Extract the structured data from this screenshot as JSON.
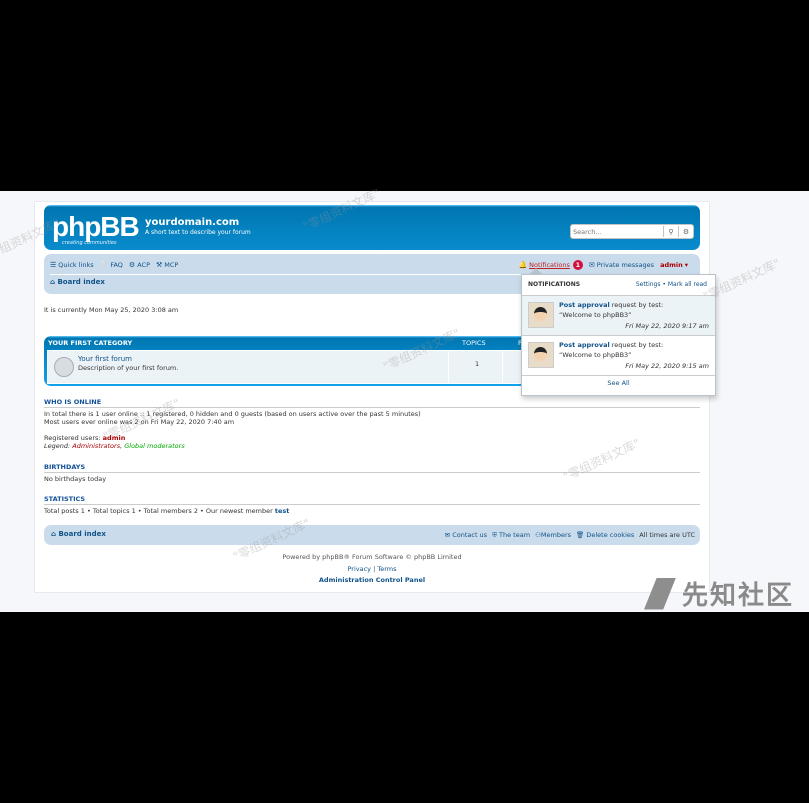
{
  "header": {
    "logo_text": "phpBB",
    "logo_tagline": "creating communities",
    "site_title": "yourdomain.com",
    "site_description": "A short text to describe your forum",
    "search_placeholder": "Search…"
  },
  "nav": {
    "quick_links": "Quick links",
    "faq": "FAQ",
    "acp": "ACP",
    "mcp": "MCP",
    "notifications": "Notifications",
    "notifications_count": "1",
    "private_messages": "Private messages",
    "username": "admin",
    "board_index": "Board index"
  },
  "current_time": "It is currently Mon May 25, 2020 3:08 am",
  "category": {
    "title": "YOUR FIRST CATEGORY",
    "col_topics": "TOPICS",
    "col_posts": "P",
    "forum_name": "Your first forum",
    "forum_desc": "Description of your first forum.",
    "topics_count": "1"
  },
  "who_is_online": {
    "heading": "WHO IS ONLINE",
    "line1": "In total there is 1 user online :: 1 registered, 0 hidden and 0 guests (based on users active over the past 5 minutes)",
    "line2": "Most users ever online was 2 on Fri May 22, 2020 7:40 am",
    "registered_label": "Registered users:",
    "registered_user": "admin",
    "legend_label": "Legend:",
    "legend_admins": "Administrators",
    "legend_sep": ",",
    "legend_gmods": "Global moderators"
  },
  "birthdays": {
    "heading": "BIRTHDAYS",
    "text": "No birthdays today"
  },
  "statistics": {
    "heading": "STATISTICS",
    "text": "Total posts 1 • Total topics 1 • Total members 2 • Our newest member",
    "newest": "test"
  },
  "footer_nav": {
    "board_index": "Board index",
    "contact": "Contact us",
    "team": "The team",
    "members": "Members",
    "delete_cookies": "Delete cookies",
    "timezone": "All times are UTC"
  },
  "footer": {
    "powered": "Powered by phpBB® Forum Software © phpBB Limited",
    "privacy": "Privacy",
    "sep": "|",
    "terms": "Terms",
    "acp": "Administration Control Panel"
  },
  "notifications_dropdown": {
    "title": "NOTIFICATIONS",
    "settings": "Settings",
    "dot": "•",
    "mark_all": "Mark all read",
    "items": [
      {
        "title_bold": "Post approval",
        "title_rest": " request by test:",
        "quote": "“Welcome to phpBB3”",
        "time": "Fri May 22, 2020 9:17 am"
      },
      {
        "title_bold": "Post approval",
        "title_rest": " request by test:",
        "quote": "“Welcome to phpBB3”",
        "time": "Fri May 22, 2020 9:15 am"
      }
    ],
    "see_all": "See All"
  },
  "watermark": {
    "text": "\"零组资料文库\"",
    "brand": "先知社区"
  },
  "colors": {
    "header_blue": "#12A3EB",
    "navbar_bg": "#cadceb",
    "link_blue": "#105289",
    "admin_red": "#AA0000",
    "badge_red": "#d31141"
  }
}
